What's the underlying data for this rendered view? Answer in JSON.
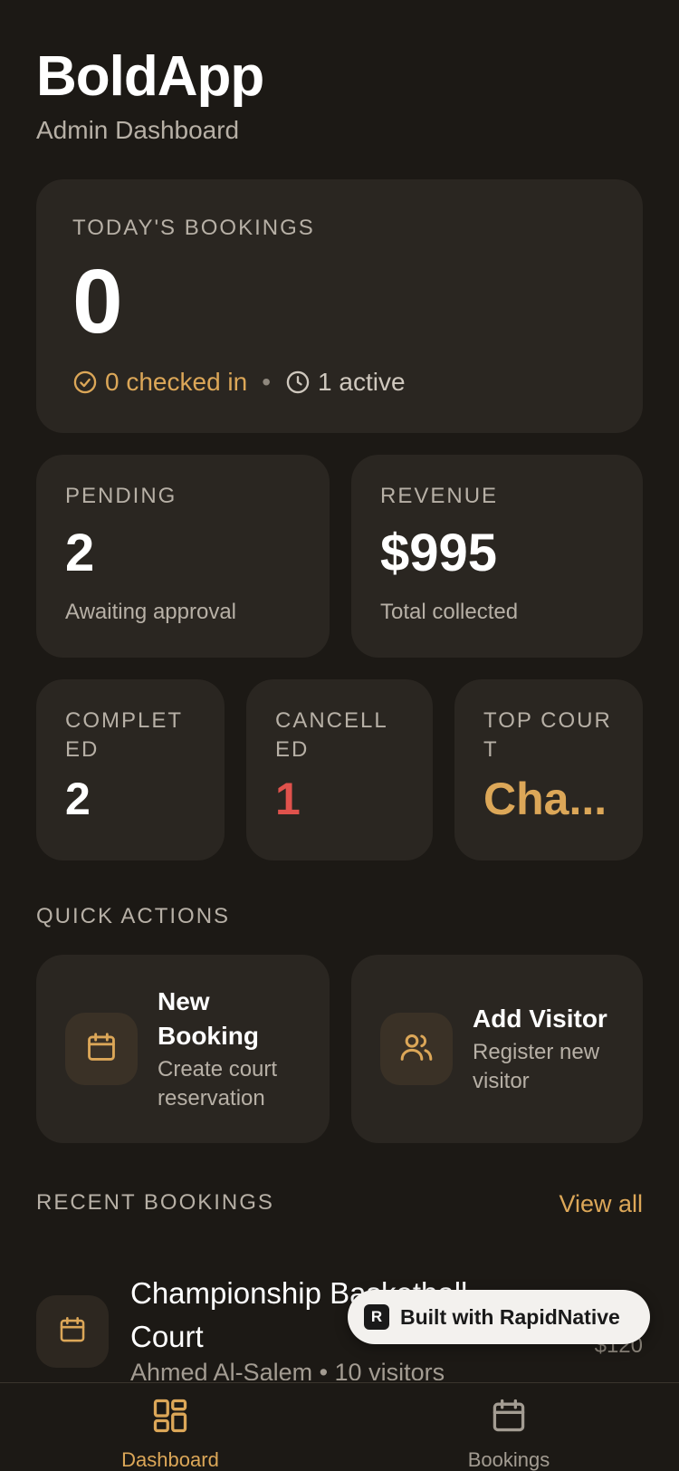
{
  "app": {
    "title": "BoldApp",
    "subtitle": "Admin Dashboard"
  },
  "today": {
    "label": "TODAY'S BOOKINGS",
    "count": "0",
    "checked_in": "0 checked in",
    "separator": "•",
    "active": "1 active"
  },
  "pending": {
    "label": "PENDING",
    "value": "2",
    "caption": "Awaiting approval"
  },
  "revenue": {
    "label": "REVENUE",
    "value": "$995",
    "caption": "Total collected"
  },
  "completed": {
    "label": "COMPLETED",
    "value": "2"
  },
  "cancelled": {
    "label": "CANCELLED",
    "value": "1"
  },
  "top_court": {
    "label": "TOP COURT",
    "value": "Cha..."
  },
  "quick_actions": {
    "title": "QUICK ACTIONS",
    "new_booking": {
      "title": "New Booking",
      "desc": "Create court reservation",
      "icon": "calendar-icon"
    },
    "add_visitor": {
      "title": "Add Visitor",
      "desc": "Register new visitor",
      "icon": "users-icon"
    }
  },
  "recent": {
    "title": "RECENT BOOKINGS",
    "view_all": "View all",
    "items": [
      {
        "court": "Championship Basketball Court",
        "sub": "Ahmed Al-Salem • 10 visitors",
        "price": "$120"
      }
    ]
  },
  "badge": {
    "text": "Built with RapidNative"
  },
  "tabs": [
    {
      "label": "Dashboard",
      "icon": "dashboard-icon",
      "active": true
    },
    {
      "label": "Bookings",
      "icon": "calendar-icon",
      "active": false
    }
  ],
  "colors": {
    "background": "#1c1915",
    "card": "#2a2621",
    "accent": "#dca758",
    "danger": "#e0524c"
  }
}
